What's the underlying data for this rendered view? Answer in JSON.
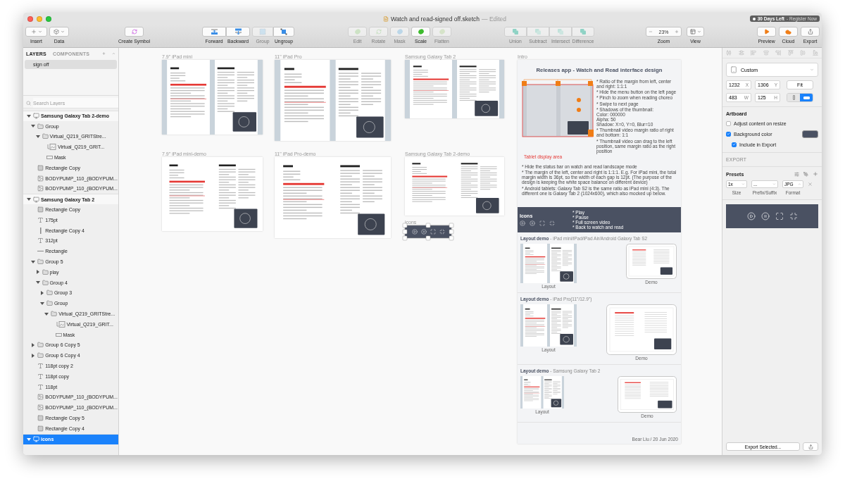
{
  "window": {
    "title": "Watch and read-signed off.sketch",
    "status": "— Edited",
    "trial": {
      "label": "30 Days Left",
      "link": "- Register Now"
    }
  },
  "toolbar": [
    {
      "items": [
        {
          "label": "Insert",
          "kind": "dropdown",
          "disabled": false
        }
      ]
    },
    {
      "items": [
        {
          "label": "Data",
          "kind": "dropdown",
          "disabled": false
        }
      ]
    },
    {
      "items": [
        {
          "label": "Create Symbol",
          "kind": "button",
          "disabled": false
        }
      ]
    },
    {
      "items": [
        {
          "label": "Forward",
          "kind": "button",
          "disabled": false
        },
        {
          "label": "Backward",
          "kind": "button",
          "disabled": false
        }
      ]
    },
    {
      "items": [
        {
          "label": "Group",
          "kind": "button",
          "disabled": true
        },
        {
          "label": "Ungroup",
          "kind": "button",
          "disabled": false
        }
      ]
    },
    {
      "items": [
        {
          "label": "Edit",
          "kind": "button",
          "disabled": true
        },
        {
          "label": "Rotate",
          "kind": "button",
          "disabled": true
        },
        {
          "label": "Mask",
          "kind": "button",
          "disabled": true
        },
        {
          "label": "Scale",
          "kind": "button",
          "disabled": false
        },
        {
          "label": "Flatten",
          "kind": "button",
          "disabled": true
        }
      ]
    },
    {
      "items": [
        {
          "label": "Union",
          "kind": "button",
          "disabled": true
        },
        {
          "label": "Subtract",
          "kind": "button",
          "disabled": true
        },
        {
          "label": "Intersect",
          "kind": "button",
          "disabled": true
        },
        {
          "label": "Difference",
          "kind": "button",
          "disabled": true
        }
      ]
    },
    {
      "items": [
        {
          "label": "Zoom",
          "kind": "zoom",
          "value": "23%",
          "disabled": false
        }
      ]
    },
    {
      "items": [
        {
          "label": "View",
          "kind": "dropdown",
          "disabled": false
        }
      ]
    },
    {
      "items": [
        {
          "label": "Preview",
          "kind": "button",
          "disabled": false
        },
        {
          "label": "Cloud",
          "kind": "button",
          "disabled": false
        },
        {
          "label": "Export",
          "kind": "button",
          "disabled": false
        }
      ]
    }
  ],
  "layers": {
    "tabs": [
      {
        "label": "LAYERS",
        "selected": true
      },
      {
        "label": "COMPONENTS",
        "selected": false
      }
    ],
    "pages": [
      {
        "label": "sign off",
        "selected": true
      }
    ],
    "search": {
      "placeholder": "Search Layers"
    },
    "tree": [
      {
        "name": "Samsung Galaxy Tab 2-demo",
        "kind": "artboard",
        "expanded": true,
        "selected": false,
        "children": [
          {
            "name": "Group",
            "kind": "group",
            "expanded": true,
            "selected": false,
            "children": [
              {
                "name": "Virtual_Q219_GRITStre...",
                "kind": "group",
                "expanded": true,
                "selected": false,
                "children": [
                  {
                    "name": "Virtual_Q219_GRIT...",
                    "kind": "masked-image",
                    "selected": false
                  },
                  {
                    "name": "Mask",
                    "kind": "mask",
                    "selected": false
                  }
                ]
              }
            ]
          },
          {
            "name": "Rectangle Copy",
            "kind": "rect",
            "selected": false
          },
          {
            "name": "BODYPUMP_110_(BODYPUM...",
            "kind": "image",
            "selected": false
          },
          {
            "name": "BODYPUMP_110_(BODYPUM...",
            "kind": "image",
            "selected": false
          }
        ]
      },
      {
        "name": "Samsung Galaxy Tab 2",
        "kind": "artboard",
        "expanded": true,
        "selected": false,
        "children": [
          {
            "name": "Rectangle Copy",
            "kind": "rect",
            "selected": false
          },
          {
            "name": "175pt",
            "kind": "text",
            "selected": false
          },
          {
            "name": "Rectangle Copy 4",
            "kind": "vline",
            "selected": false
          },
          {
            "name": "312pt",
            "kind": "text",
            "selected": false
          },
          {
            "name": "Rectangle",
            "kind": "line",
            "selected": false
          },
          {
            "name": "Group 5",
            "kind": "group",
            "expanded": true,
            "selected": false,
            "children": [
              {
                "name": "play",
                "kind": "group",
                "expanded": false,
                "selected": false
              },
              {
                "name": "Group 4",
                "kind": "group",
                "expanded": true,
                "selected": false,
                "children": [
                  {
                    "name": "Group 3",
                    "kind": "group",
                    "expanded": false,
                    "selected": false
                  },
                  {
                    "name": "Group",
                    "kind": "group",
                    "expanded": true,
                    "selected": false,
                    "children": [
                      {
                        "name": "Virtual_Q219_GRITStre...",
                        "kind": "group",
                        "expanded": true,
                        "selected": false,
                        "children": [
                          {
                            "name": "Virtual_Q219_GRIT...",
                            "kind": "masked-image",
                            "selected": false
                          },
                          {
                            "name": "Mask",
                            "kind": "mask",
                            "selected": false
                          }
                        ]
                      }
                    ]
                  }
                ]
              }
            ]
          },
          {
            "name": "Group 6 Copy 5",
            "kind": "group",
            "expanded": false,
            "selected": false
          },
          {
            "name": "Group 6 Copy 4",
            "kind": "group",
            "expanded": false,
            "selected": false
          },
          {
            "name": "118pt copy 2",
            "kind": "text",
            "selected": false
          },
          {
            "name": "118pt copy",
            "kind": "text",
            "selected": false
          },
          {
            "name": "118pt",
            "kind": "text",
            "selected": false
          },
          {
            "name": "BODYPUMP_110_(BODYPUM...",
            "kind": "image",
            "selected": false
          },
          {
            "name": "BODYPUMP_110_(BODYPUM...",
            "kind": "image",
            "selected": false
          },
          {
            "name": "Rectangle Copy 5",
            "kind": "rect",
            "selected": false
          },
          {
            "name": "Rectangle Copy 4",
            "kind": "rect",
            "selected": false
          }
        ]
      },
      {
        "name": "icons",
        "kind": "artboard",
        "expanded": true,
        "selected": true
      }
    ]
  },
  "canvas": {
    "artboards": [
      {
        "name": "7.9\" iPad mini",
        "kind": "device",
        "selected": false
      },
      {
        "name": "11\" iPad Pro",
        "kind": "device",
        "selected": false
      },
      {
        "name": "Samsung Galaxy Tab 2",
        "kind": "device",
        "selected": false
      },
      {
        "name": "7.9\" iPad mini-demo",
        "kind": "demo",
        "selected": false
      },
      {
        "name": "11\" iPad Pro-demo",
        "kind": "demo",
        "selected": false
      },
      {
        "name": "Samsung Galaxy Tab 2-demo",
        "kind": "demo",
        "selected": false
      },
      {
        "name": "icons",
        "kind": "icons",
        "selected": true
      },
      {
        "name": "Intro",
        "kind": "intro",
        "selected": false
      }
    ]
  },
  "intro": {
    "title": "Releases app - Watch and Read interface design",
    "display_area": "Tablet display area",
    "annotations": [
      "* Ratio of the margin from left, center and right: 1:1:1",
      "* Hide the menu button on the left page",
      "* Pinch to zoom when reading choreo",
      "* Swipe to next page",
      "* Shadows of the thumbnail:\nColor: 000000\nAlpha: 50\nShadow: X=0, Y=0, Blur=10",
      "* Thumbnail video margin ratio of right and bottom: 1:1",
      "* Thumbnail video can drag to the left position, same margin ratio as the right position"
    ],
    "notes": [
      "* Hide the status bar on watch and read landscape mode",
      "* The margin of the left, center and right is 1:1:1. E.g. For iPad mini, the total margin width is 36pt, so the width of each gap is 12pt. (The purpose of the design is keeping the white space balance on different device)",
      "* Android tablets: Galaxy Tab S2 is the same ratio as iPad mini (4:3). The different one is Galaxy Tab 2 (1024x600), which also mocked up below."
    ],
    "icons": {
      "title": "Icons",
      "notes": [
        "* Play",
        "* Pause",
        "* Full screen video",
        "* Back to watch and read"
      ]
    },
    "demos": [
      {
        "heading": "**Layout demo** - iPad mini/iPad/iPad Air/Android Galaxy Tab S2",
        "layout_caption": "Layout",
        "demo_caption": "Demo"
      },
      {
        "heading": "**Layout demo** - iPad Pro(11\"/12.9\")",
        "layout_caption": "Layout",
        "demo_caption": "Demo"
      },
      {
        "heading": "**Layout demo** - Samsung Galaxy Tab 2",
        "layout_caption": "Layout",
        "demo_caption": "Demo"
      }
    ],
    "footer": "Bear Liu / 20 Jun 2020"
  },
  "inspector": {
    "preset": "Custom",
    "fields": [
      {
        "value": "1232",
        "label": "X"
      },
      {
        "value": "1306",
        "label": "Y"
      },
      {
        "value": "483",
        "label": "W"
      },
      {
        "value": "125",
        "label": "H"
      }
    ],
    "fit_button": "Fit",
    "orientation": [
      {
        "kind": "portrait",
        "selected": false
      },
      {
        "kind": "landscape",
        "selected": true
      }
    ],
    "artboard": {
      "title": "Artboard",
      "options": [
        {
          "label": "Adjust content on resize",
          "checked": false
        },
        {
          "label": "Background color",
          "checked": true,
          "children": [
            {
              "label": "Include in Export",
              "checked": true
            }
          ]
        }
      ]
    },
    "export": {
      "header": "EXPORT",
      "presets_title": "Presets",
      "size": "1x",
      "prefix": "...",
      "format": "JPG",
      "labels": [
        "Size",
        "Prefix/Suffix",
        "Format"
      ],
      "button": "Export Selected..."
    }
  }
}
